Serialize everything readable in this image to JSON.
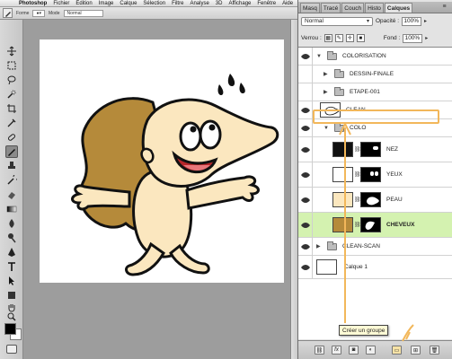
{
  "menubar": {
    "items": [
      "Photoshop",
      "Fichier",
      "Édition",
      "Image",
      "Calque",
      "Sélection",
      "Filtre",
      "Analyse",
      "3D",
      "Affichage",
      "Fenêtre",
      "Aide"
    ]
  },
  "options": {
    "label_size": "Forme",
    "mode_label": "Mode",
    "mode_value": "Normal"
  },
  "panel": {
    "tabs": [
      "Masq",
      "Tracé",
      "Couch",
      "Histo",
      "Calques"
    ],
    "blend_mode": "Normal",
    "opacity_label": "Opacité :",
    "opacity_value": "100%",
    "lock_label": "Verrou :",
    "fill_label": "Fond :",
    "fill_value": "100%",
    "layers": [
      {
        "name": "COLORISATION",
        "kind": "group",
        "open": true,
        "visible": true,
        "indent": 0
      },
      {
        "name": "DESSIN-FINALE",
        "kind": "group",
        "open": false,
        "visible": false,
        "indent": 1
      },
      {
        "name": "ETAPE-001",
        "kind": "group",
        "open": false,
        "visible": false,
        "indent": 1
      },
      {
        "name": "CLEAN",
        "kind": "layer",
        "visible": true,
        "indent": 1
      },
      {
        "name": "COLO",
        "kind": "group",
        "open": true,
        "visible": true,
        "indent": 1
      },
      {
        "name": "NEZ",
        "kind": "masked",
        "visible": true,
        "indent": 2
      },
      {
        "name": "YEUX",
        "kind": "masked",
        "visible": true,
        "indent": 2
      },
      {
        "name": "PEAU",
        "kind": "masked",
        "visible": true,
        "indent": 2
      },
      {
        "name": "CHEVEUX",
        "kind": "masked",
        "visible": true,
        "indent": 2,
        "selected": true
      },
      {
        "name": "CLEAN-SCAN",
        "kind": "group",
        "open": false,
        "visible": true,
        "indent": 0
      },
      {
        "name": "Calque 1",
        "kind": "layer",
        "visible": true,
        "indent": 0
      }
    ],
    "tooltip": "Créer un groupe"
  },
  "colors": {
    "hair": "#b58a3a",
    "skin": "#fbe7bf",
    "selected_row": "#d4f2b0",
    "annotation": "#f2b75a"
  }
}
